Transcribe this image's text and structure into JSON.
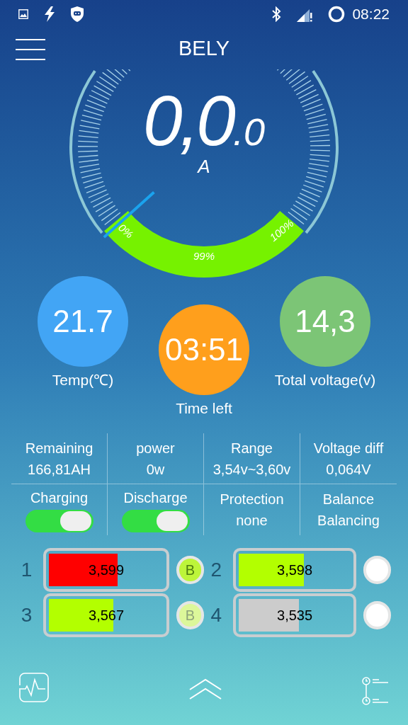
{
  "status_bar": {
    "time": "08:22"
  },
  "header": {
    "title": "BELY"
  },
  "gauge": {
    "reading": "0,0",
    "decimal": ".0",
    "unit": "A",
    "start_label": "0%",
    "percent_label": "99%",
    "end_label": "100%"
  },
  "stats": [
    {
      "label": "Temp(℃)",
      "value": "21.7",
      "color": "#42a5f5"
    },
    {
      "label": "Time left",
      "value": "03:51",
      "color": "#ff9f1c"
    },
    {
      "label": "Total voltage(v)",
      "value": "14,3",
      "color": "#7cc576"
    }
  ],
  "info_rows": [
    [
      {
        "kind": "text",
        "label": "Remaining",
        "value": "166,81AH"
      },
      {
        "kind": "text",
        "label": "power",
        "value": "0w"
      },
      {
        "kind": "text",
        "label": "Range",
        "value": "3,54v~3,60v"
      },
      {
        "kind": "text",
        "label": "Voltage diff",
        "value": "0,064V"
      }
    ],
    [
      {
        "kind": "toggle",
        "label": "Charging",
        "on": true
      },
      {
        "kind": "toggle",
        "label": "Discharge",
        "on": true
      },
      {
        "kind": "text",
        "label": "Protection",
        "value": "none"
      },
      {
        "kind": "text",
        "label": "Balance",
        "value": "Balancing"
      }
    ]
  ],
  "cells": [
    {
      "number": "1",
      "value": "3,599",
      "level": 0.6,
      "color": "#ff0000",
      "badge": "B",
      "balancing": true
    },
    {
      "number": "2",
      "value": "3,598",
      "level": 0.58,
      "color": "#b3ff00"
    },
    {
      "number": "3",
      "value": "3,567",
      "level": 0.56,
      "color": "#b3ff00",
      "badge": "B",
      "balancing": false
    },
    {
      "number": "4",
      "value": "3,535",
      "level": 0.54,
      "color": "#cccccc"
    }
  ]
}
